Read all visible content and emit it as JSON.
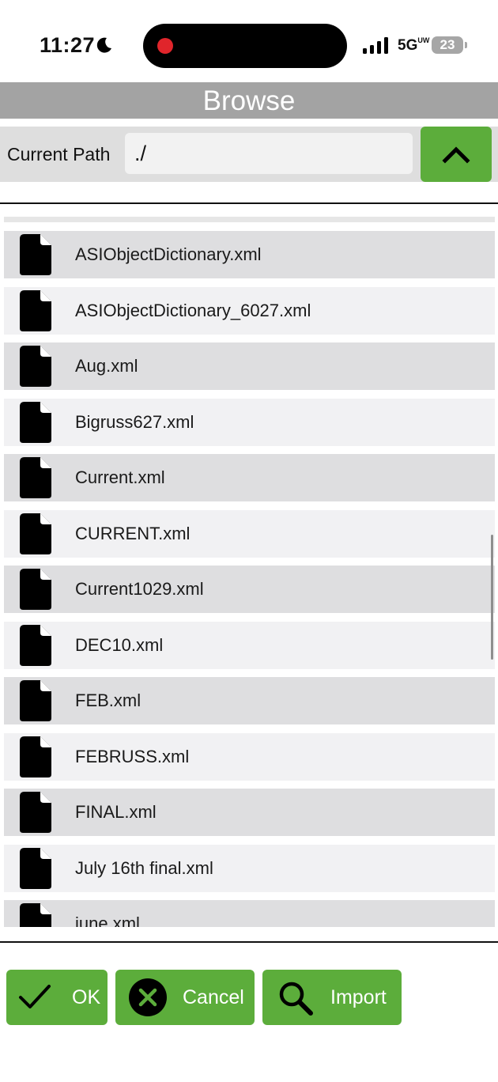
{
  "status_bar": {
    "time": "11:27",
    "network": "5G",
    "network_sup": "UW",
    "battery": "23"
  },
  "header": {
    "title": "Browse"
  },
  "path": {
    "label": "Current Path",
    "value": "./"
  },
  "files": [
    "ASIObjectDictionary.xml",
    "ASIObjectDictionary_6027.xml",
    "Aug.xml",
    "Bigruss627.xml",
    "Current.xml",
    "CURRENT.xml",
    "Current1029.xml",
    "DEC10.xml",
    "FEB.xml",
    "FEBRUSS.xml",
    "FINAL.xml",
    "July 16th final.xml",
    "june.xml"
  ],
  "buttons": {
    "ok": "OK",
    "cancel": "Cancel",
    "import": "Import"
  },
  "colors": {
    "accent": "#5cad3b",
    "header": "#a3a3a3",
    "recording": "#e0252b"
  },
  "icons": [
    "moon-icon",
    "signal-icon",
    "battery-icon",
    "chevron-up-icon",
    "file-icon",
    "checkmark-icon",
    "cancel-icon",
    "search-icon"
  ]
}
